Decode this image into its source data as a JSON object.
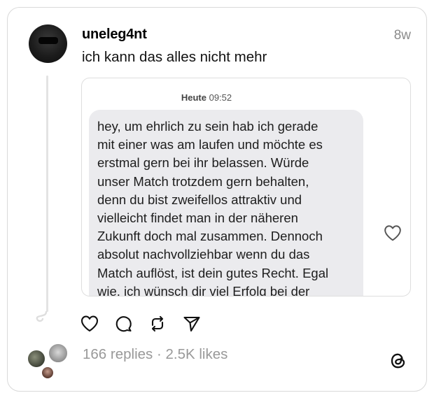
{
  "post": {
    "username": "uneleg4nt",
    "time_ago": "8w",
    "text": "ich kann das alles nicht mehr"
  },
  "embed": {
    "date_label": "Heute",
    "time_label": "09:52",
    "message_lines": [
      "hey, um ehrlich zu sein hab ich gerade",
      "mit einer was am laufen und möchte es",
      "erstmal gern bei ihr belassen. Würde",
      "unser Match trotzdem gern behalten,",
      "denn du bist zweifellos attraktiv und",
      "vielleicht findet man in der näheren",
      "Zukunft doch mal zusammen. Dennoch",
      "absolut nachvollziehbar wenn du das",
      "Match auflöst, ist dein gutes Recht. Egal",
      "wie, ich wünsch dir viel Erfolg bei der"
    ]
  },
  "footer": {
    "replies": "166 replies",
    "separator": " · ",
    "likes": "2.5K likes"
  },
  "icons": {
    "like": "heart-icon",
    "reply": "comment-icon",
    "repost": "repost-icon",
    "share": "send-icon",
    "brand": "threads-logo-icon"
  },
  "colors": {
    "muted": "#8a8a8a",
    "bubble": "#ebebee",
    "border": "#d9d9d9"
  }
}
